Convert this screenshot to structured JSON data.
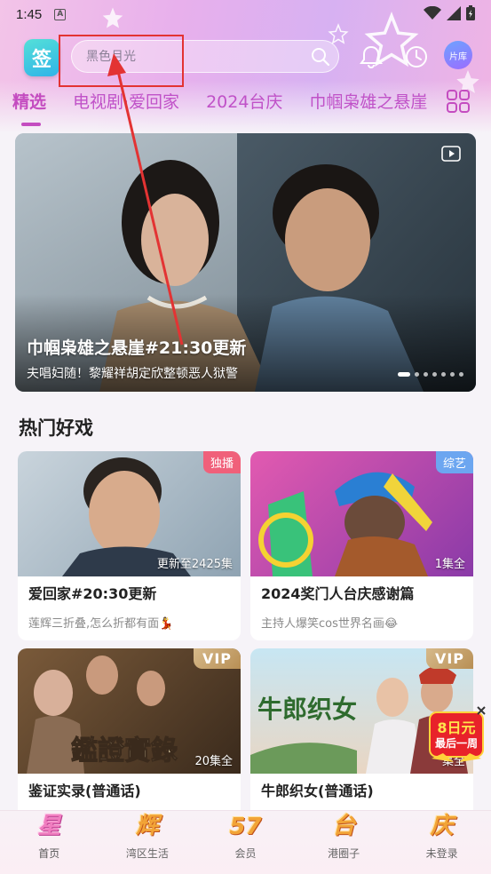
{
  "status_bar": {
    "time": "1:45",
    "indicator": "A"
  },
  "header": {
    "logo_char": "签",
    "search_placeholder": "黑色月光",
    "library_label": "片库"
  },
  "tabs": [
    {
      "label": "精选",
      "active": true
    },
    {
      "label": "电视剧·爱回家",
      "active": false
    },
    {
      "label": "2024台庆",
      "active": false
    },
    {
      "label": "巾帼枭雄之悬崖",
      "active": false
    }
  ],
  "banner": {
    "title": "巾帼枭雄之悬崖#21:30更新",
    "subtitle": "夫唱妇随！黎耀祥胡定欣整顿恶人狱警",
    "dot_count": 8,
    "active_dot": 0
  },
  "section": {
    "title": "热门好戏"
  },
  "cards": [
    {
      "title": "爱回家#20:30更新",
      "desc": "莲辉三折叠,怎么折都有面💃",
      "badge": "独播",
      "badge_color": "#f0607a",
      "episodes": "更新至2425集",
      "vip": false
    },
    {
      "title": "2024奖门人台庆感谢篇",
      "desc": "主持人爆笑cos世界名画😂",
      "badge": "综艺",
      "badge_color": "#6ca6f0",
      "episodes": "1集全",
      "vip": false
    },
    {
      "title": "鉴证实录(普通话)",
      "desc": "",
      "badge": "VIP",
      "episodes": "20集全",
      "vip": true,
      "poster_text": "鑑證實錄"
    },
    {
      "title": "牛郎织女(普通话)",
      "desc": "",
      "badge": "VIP",
      "episodes": "集全",
      "vip": true,
      "poster_text": "牛郎织女"
    }
  ],
  "promo": {
    "line1": "8日元",
    "line2": "最后一周"
  },
  "bottom_nav": [
    {
      "glyph": "星",
      "label": "首页",
      "active": true
    },
    {
      "glyph": "辉",
      "label": "湾区生活",
      "active": false
    },
    {
      "glyph": "57",
      "label": "会员",
      "active": false
    },
    {
      "glyph": "台",
      "label": "港圈子",
      "active": false
    },
    {
      "glyph": "庆",
      "label": "未登录",
      "active": false
    }
  ],
  "colors": {
    "accent": "#c44cc0",
    "annotation_red": "#e33333",
    "vip_gold": "#c9a56f"
  }
}
